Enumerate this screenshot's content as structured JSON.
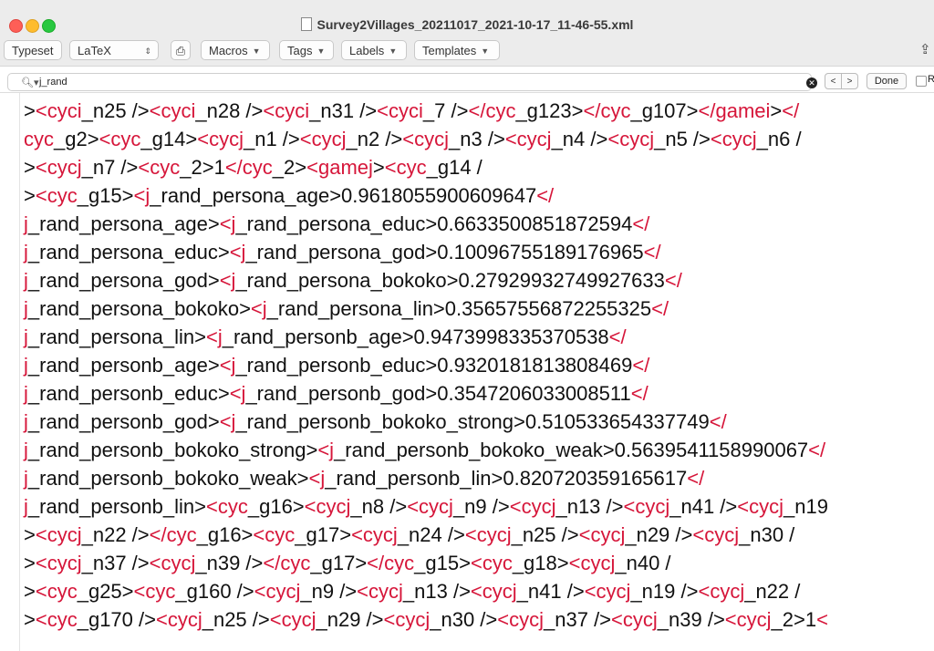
{
  "window": {
    "title": "Survey2Villages_20211017_2021-10-17_11-46-55.xml"
  },
  "toolbar": {
    "typeset": "Typeset",
    "latex": "LaTeX",
    "macros": "Macros",
    "tags": "Tags",
    "labels": "Labels",
    "templates": "Templates"
  },
  "find": {
    "value": "j_rand",
    "done": "Done",
    "prev": "<",
    "next": ">",
    "regex_label": "R"
  },
  "editor": {
    "lines": [
      "><cyci_n25 /><cyci_n28 /><cyci_n31 /><cyci_7 /></cyc_g123></cyc_g107></gamei></",
      "cyc_g2><cyc_g14><cycj_n1 /><cycj_n2 /><cycj_n3 /><cycj_n4 /><cycj_n5 /><cycj_n6 /",
      "><cycj_n7 /><cyc_2>1</cyc_2><gamej><cyc_g14 /",
      "><cyc_g15><j_rand_persona_age>0.9618055900609647</",
      "j_rand_persona_age><j_rand_persona_educ>0.6633500851872594</",
      "j_rand_persona_educ><j_rand_persona_god>0.10096755189176965</",
      "j_rand_persona_god><j_rand_persona_bokoko>0.27929932749927633</",
      "j_rand_persona_bokoko><j_rand_persona_lin>0.35657556872255325</",
      "j_rand_persona_lin><j_rand_personb_age>0.9473998335370538</",
      "j_rand_personb_age><j_rand_personb_educ>0.9320181813808469</",
      "j_rand_personb_educ><j_rand_personb_god>0.3547206033008511</",
      "j_rand_personb_god><j_rand_personb_bokoko_strong>0.510533654337749</",
      "j_rand_personb_bokoko_strong><j_rand_personb_bokoko_weak>0.5639541158990067</",
      "j_rand_personb_bokoko_weak><j_rand_personb_lin>0.820720359165617</",
      "j_rand_personb_lin><cyc_g16><cycj_n8 /><cycj_n9 /><cycj_n13 /><cycj_n41 /><cycj_n19",
      "><cycj_n22 /></cyc_g16><cyc_g17><cycj_n24 /><cycj_n25 /><cycj_n29 /><cycj_n30 /",
      "><cycj_n37 /><cycj_n39 /></cyc_g17></cyc_g15><cyc_g18><cycj_n40 /",
      "><cyc_g25><cyc_g160 /><cycj_n9 /><cycj_n13 /><cycj_n41 /><cycj_n19 /><cycj_n22 /",
      "><cyc_g170 /><cycj_n25 /><cycj_n29 /><cycj_n30 /><cycj_n37 /><cycj_n39 /><cycj_2>1<"
    ]
  },
  "colors": {
    "tag": "#d6163a",
    "text": "#111111",
    "chrome": "#ececec"
  }
}
